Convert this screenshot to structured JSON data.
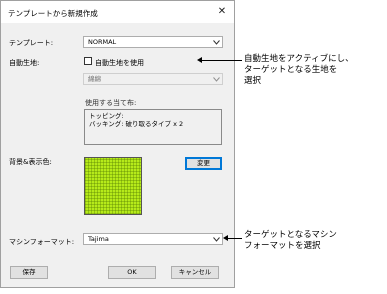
{
  "dialog": {
    "title": "テンプレートから新規作成",
    "close_glyph": "✕"
  },
  "template": {
    "label": "テンプレート:",
    "value": "NORMAL"
  },
  "auto_fabric": {
    "label": "自動生地:",
    "checkbox_label": "自動生地を使用",
    "checked": false,
    "fabric_value": "綿綿",
    "usage_label": "使用する当て布:",
    "usage_lines": [
      "トッピング:",
      "バッキング: 破り取るタイプ x 2"
    ]
  },
  "background": {
    "label": "背景&表示色:",
    "swatch_color": "#b6ea1a",
    "change_button": "変更"
  },
  "machine_format": {
    "label": "マシンフォーマット:",
    "value": "Tajima"
  },
  "buttons": {
    "save": "保存",
    "ok": "OK",
    "cancel": "キャンセル"
  },
  "callouts": {
    "auto_fabric_lines": [
      "自動生地をアクティブにし、",
      "ターゲットとなる生地を",
      "選択"
    ],
    "machine_format_lines": [
      "ターゲットとなるマシン",
      "フォーマットを選択"
    ]
  }
}
